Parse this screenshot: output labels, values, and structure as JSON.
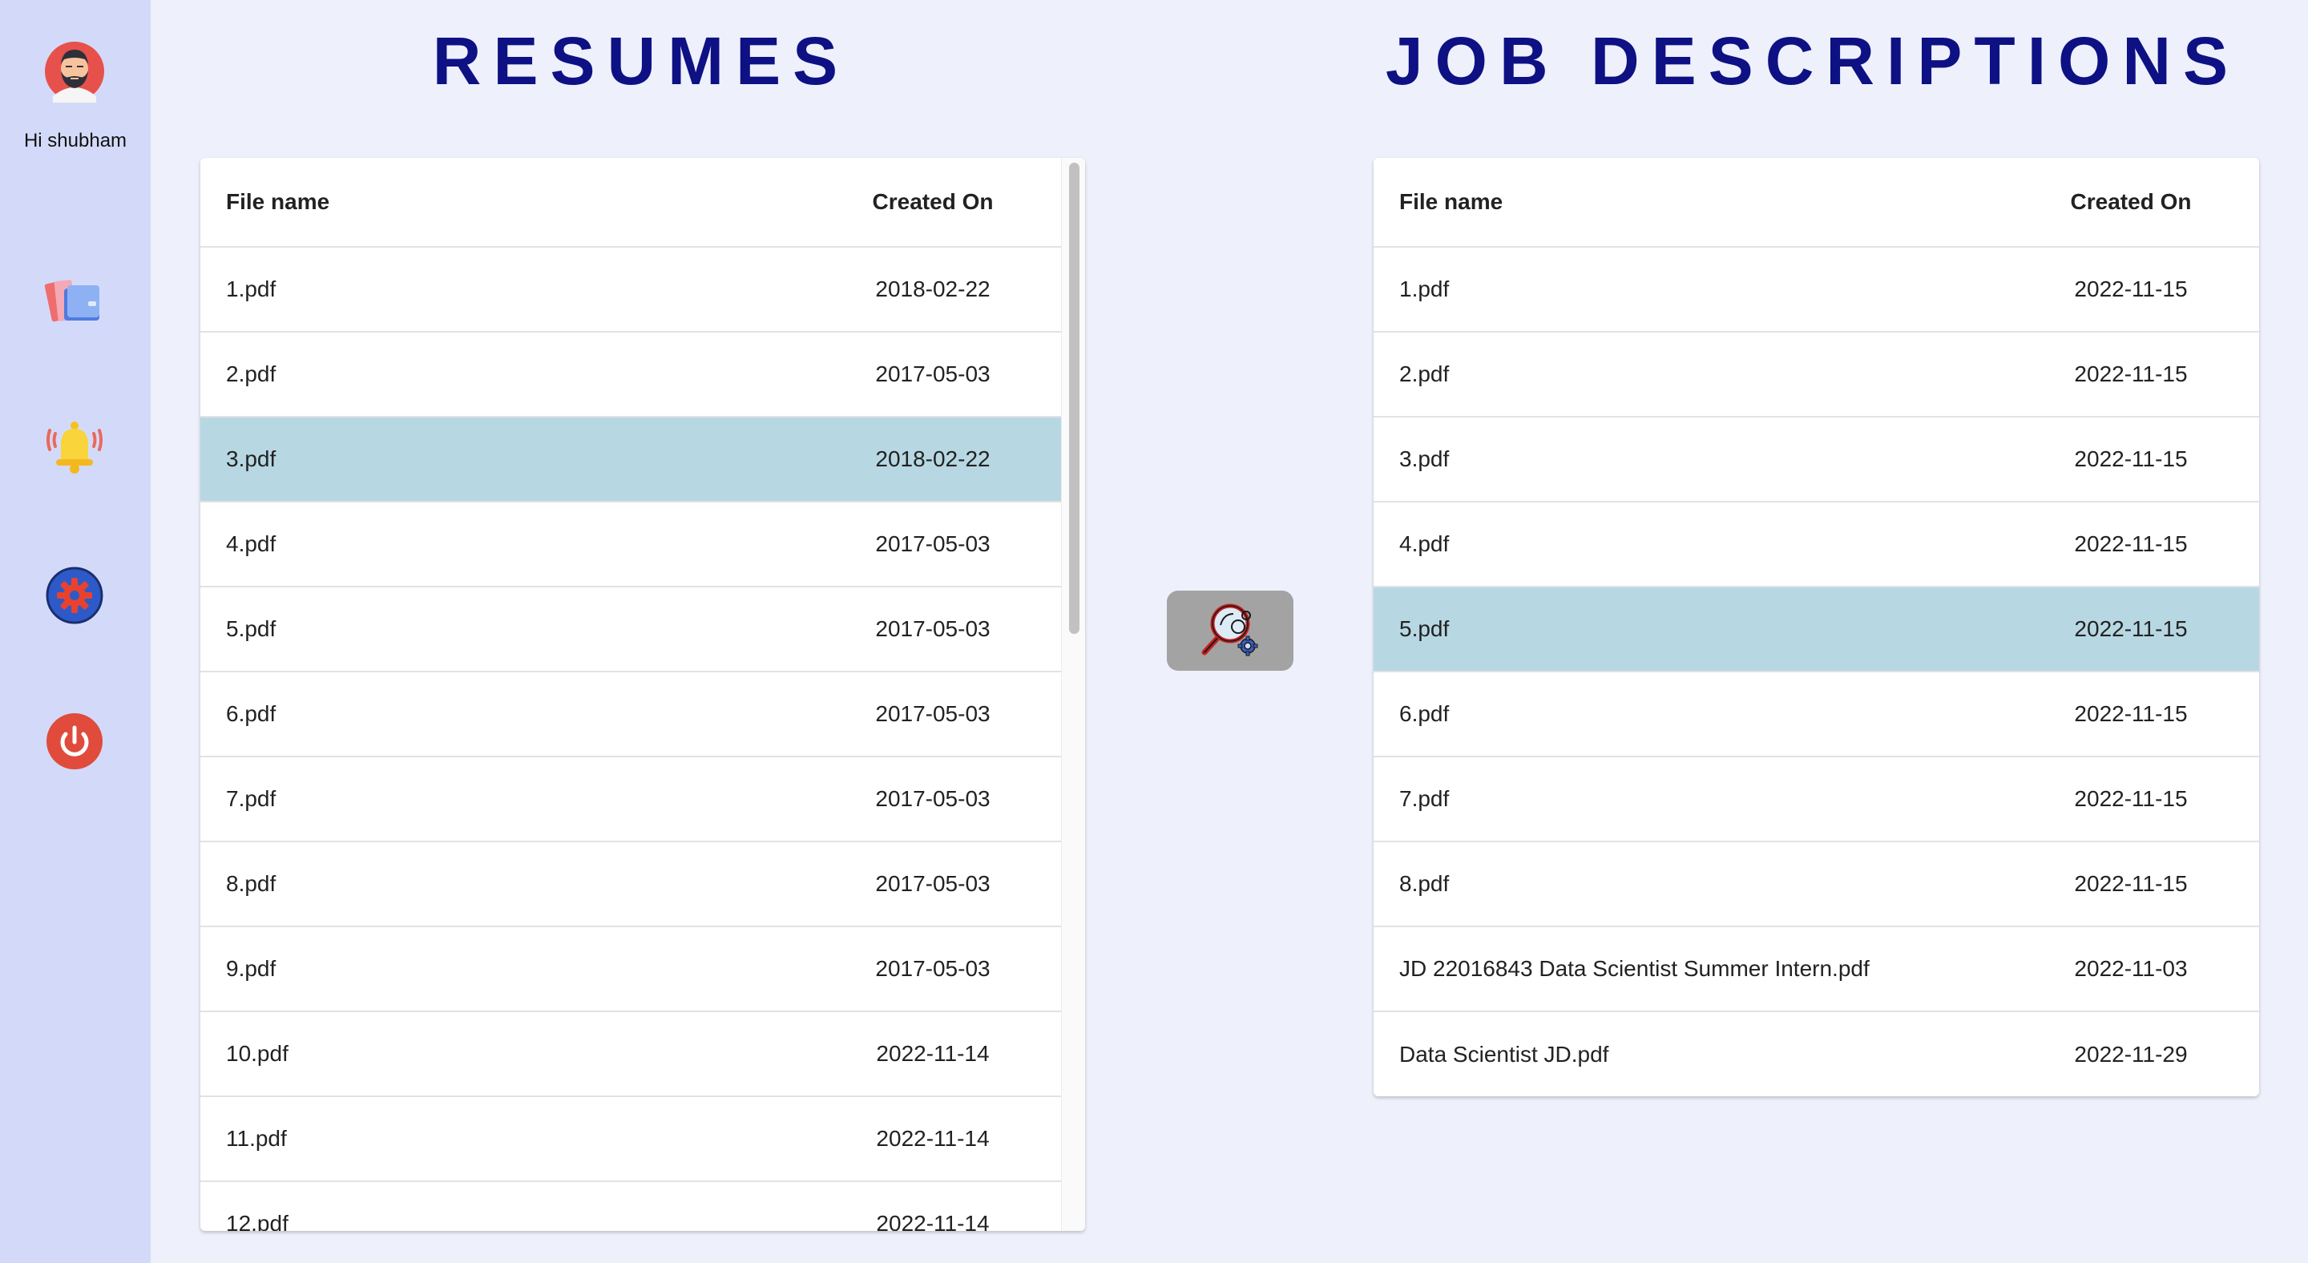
{
  "sidebar": {
    "greeting": "Hi shubham",
    "nav": [
      "files-icon",
      "bell-icon",
      "settings-icon",
      "power-icon"
    ]
  },
  "resumes": {
    "title": "RESUMES",
    "col_name": "File name",
    "col_date": "Created On",
    "selected_index": 2,
    "rows": [
      {
        "name": "1.pdf",
        "date": "2018-02-22"
      },
      {
        "name": "2.pdf",
        "date": "2017-05-03"
      },
      {
        "name": "3.pdf",
        "date": "2018-02-22"
      },
      {
        "name": "4.pdf",
        "date": "2017-05-03"
      },
      {
        "name": "5.pdf",
        "date": "2017-05-03"
      },
      {
        "name": "6.pdf",
        "date": "2017-05-03"
      },
      {
        "name": "7.pdf",
        "date": "2017-05-03"
      },
      {
        "name": "8.pdf",
        "date": "2017-05-03"
      },
      {
        "name": "9.pdf",
        "date": "2017-05-03"
      },
      {
        "name": "10.pdf",
        "date": "2022-11-14"
      },
      {
        "name": "11.pdf",
        "date": "2022-11-14"
      },
      {
        "name": "12.pdf",
        "date": "2022-11-14"
      }
    ]
  },
  "jobs": {
    "title": "JOB DESCRIPTIONS",
    "col_name": "File name",
    "col_date": "Created On",
    "selected_index": 4,
    "rows": [
      {
        "name": "1.pdf",
        "date": "2022-11-15"
      },
      {
        "name": "2.pdf",
        "date": "2022-11-15"
      },
      {
        "name": "3.pdf",
        "date": "2022-11-15"
      },
      {
        "name": "4.pdf",
        "date": "2022-11-15"
      },
      {
        "name": "5.pdf",
        "date": "2022-11-15"
      },
      {
        "name": "6.pdf",
        "date": "2022-11-15"
      },
      {
        "name": "7.pdf",
        "date": "2022-11-15"
      },
      {
        "name": "8.pdf",
        "date": "2022-11-15"
      },
      {
        "name": "JD 22016843 Data Scientist Summer Intern.pdf",
        "date": "2022-11-03"
      },
      {
        "name": "Data Scientist JD.pdf",
        "date": "2022-11-29"
      }
    ]
  },
  "match_button": {
    "icon": "search-gear-icon"
  },
  "colors": {
    "page_bg": "#eef0fc",
    "sidebar_bg": "#d3daf9",
    "heading": "#0e1183",
    "selected_row": "#b7d8e3",
    "button_bg": "#a3a3a3"
  }
}
